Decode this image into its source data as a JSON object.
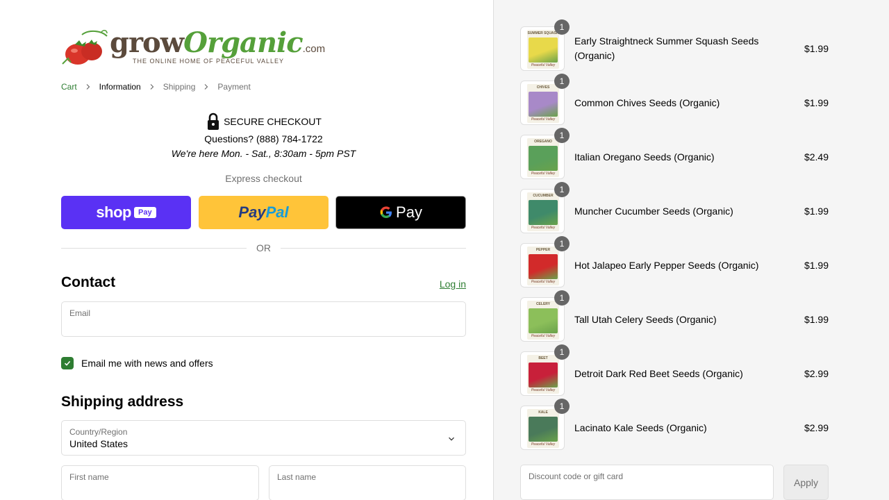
{
  "logo": {
    "grow": "grow",
    "organic": "Organic",
    "com": ".com",
    "tagline": "THE ONLINE HOME OF PEACEFUL VALLEY"
  },
  "breadcrumb": [
    {
      "label": "Cart",
      "state": "link"
    },
    {
      "label": "Information",
      "state": "current"
    },
    {
      "label": "Shipping",
      "state": "inactive"
    },
    {
      "label": "Payment",
      "state": "inactive"
    }
  ],
  "secure": {
    "title": "SECURE CHECKOUT",
    "phone": "Questions? (888) 784-1722",
    "hours": "We're here Mon. - Sat., 8:30am - 5pm PST"
  },
  "express": {
    "label": "Express checkout",
    "shop_text": "shop",
    "shop_pay": "Pay",
    "paypal_1": "Pay",
    "paypal_2": "Pal",
    "gpay_g": "G",
    "gpay_text": "Pay"
  },
  "or_label": "OR",
  "contact": {
    "title": "Contact",
    "login": "Log in",
    "email_label": "Email",
    "email_value": "",
    "newsletter_label": "Email me with news and offers",
    "newsletter_checked": true
  },
  "shipping": {
    "title": "Shipping address",
    "country_label": "Country/Region",
    "country_value": "United States",
    "first_name_label": "First name",
    "last_name_label": "Last name"
  },
  "cart_items": [
    {
      "name": "Early Straightneck Summer Squash Seeds (Organic)",
      "price": "$1.99",
      "qty": "1",
      "packet": "SUMMER SQUASH",
      "art_color": "#e8d94a",
      "icon": "squash-seed-packet-icon"
    },
    {
      "name": "Common Chives Seeds (Organic)",
      "price": "$1.99",
      "qty": "1",
      "packet": "CHIVES",
      "art_color": "#a889c8",
      "icon": "chives-seed-packet-icon"
    },
    {
      "name": "Italian Oregano Seeds (Organic)",
      "price": "$2.49",
      "qty": "1",
      "packet": "OREGANO",
      "art_color": "#5aa05a",
      "icon": "oregano-seed-packet-icon"
    },
    {
      "name": "Muncher Cucumber Seeds (Organic)",
      "price": "$1.99",
      "qty": "1",
      "packet": "CUCUMBER",
      "art_color": "#3f8a6a",
      "icon": "cucumber-seed-packet-icon"
    },
    {
      "name": "Hot Jalapeo Early Pepper Seeds (Organic)",
      "price": "$1.99",
      "qty": "1",
      "packet": "PEPPER",
      "art_color": "#d22a2a",
      "icon": "pepper-seed-packet-icon"
    },
    {
      "name": "Tall Utah Celery Seeds (Organic)",
      "price": "$1.99",
      "qty": "1",
      "packet": "CELERY",
      "art_color": "#8cbf5a",
      "icon": "celery-seed-packet-icon"
    },
    {
      "name": "Detroit Dark Red Beet Seeds (Organic)",
      "price": "$2.99",
      "qty": "1",
      "packet": "BEET",
      "art_color": "#c8203a",
      "icon": "beet-seed-packet-icon"
    },
    {
      "name": "Lacinato Kale Seeds (Organic)",
      "price": "$2.99",
      "qty": "1",
      "packet": "KALE",
      "art_color": "#4a7a5a",
      "icon": "kale-seed-packet-icon"
    }
  ],
  "packet_brand": "Peaceful Valley",
  "discount": {
    "label": "Discount code or gift card",
    "value": "",
    "apply": "Apply"
  },
  "colors": {
    "accent_green": "#2e7d32",
    "shop_purple": "#5a31f4",
    "paypal_yellow": "#ffc439",
    "summary_bg": "#f5f5f5"
  }
}
